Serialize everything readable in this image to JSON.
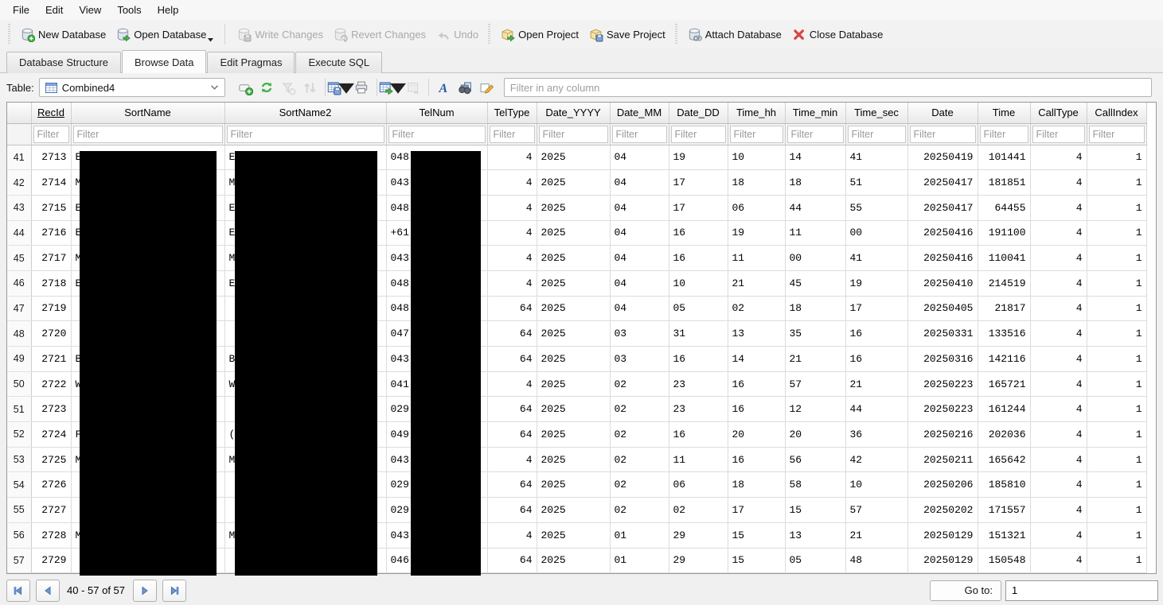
{
  "menu": {
    "items": [
      "File",
      "Edit",
      "View",
      "Tools",
      "Help"
    ]
  },
  "toolbar": {
    "buttons": [
      {
        "label": "New Database",
        "icon": "db-new",
        "enabled": true,
        "dropdown": false,
        "sep": "none"
      },
      {
        "label": "Open Database",
        "icon": "db-open",
        "enabled": true,
        "dropdown": true,
        "sep": "none"
      },
      {
        "label": "Write Changes",
        "icon": "db-write",
        "enabled": false,
        "dropdown": false,
        "sep": "line"
      },
      {
        "label": "Revert Changes",
        "icon": "db-revert",
        "enabled": false,
        "dropdown": false,
        "sep": "none"
      },
      {
        "label": "Undo",
        "icon": "undo",
        "enabled": false,
        "dropdown": false,
        "sep": "none"
      },
      {
        "label": "Open Project",
        "icon": "project-open",
        "enabled": true,
        "dropdown": false,
        "sep": "handle"
      },
      {
        "label": "Save Project",
        "icon": "project-save",
        "enabled": true,
        "dropdown": false,
        "sep": "none"
      },
      {
        "label": "Attach Database",
        "icon": "db-attach",
        "enabled": true,
        "dropdown": false,
        "sep": "handle"
      },
      {
        "label": "Close Database",
        "icon": "close-db",
        "enabled": true,
        "dropdown": false,
        "sep": "none"
      }
    ]
  },
  "tabs": [
    {
      "label": "Database Structure",
      "active": false
    },
    {
      "label": "Browse Data",
      "active": true
    },
    {
      "label": "Edit Pragmas",
      "active": false
    },
    {
      "label": "Execute SQL",
      "active": false
    }
  ],
  "browse_toolbar": {
    "table_label": "Table:",
    "table_value": "Combined4",
    "filter_placeholder": "Filter in any column",
    "icons": [
      {
        "name": "new-record",
        "enabled": true,
        "dropdown": false,
        "sep": false
      },
      {
        "name": "refresh",
        "enabled": true,
        "dropdown": false,
        "sep": false
      },
      {
        "name": "clear-filters",
        "enabled": false,
        "dropdown": false,
        "sep": false
      },
      {
        "name": "sort-records",
        "enabled": false,
        "dropdown": false,
        "sep": false
      },
      {
        "name": "save-table",
        "enabled": true,
        "dropdown": true,
        "sep": true
      },
      {
        "name": "print",
        "enabled": true,
        "dropdown": false,
        "sep": false
      },
      {
        "name": "insert-values",
        "enabled": true,
        "dropdown": true,
        "sep": true
      },
      {
        "name": "copy-table",
        "enabled": false,
        "dropdown": false,
        "sep": false
      },
      {
        "name": "font",
        "enabled": true,
        "dropdown": false,
        "sep": true
      },
      {
        "name": "find-in-cells",
        "enabled": true,
        "dropdown": false,
        "sep": false
      },
      {
        "name": "edit-cell",
        "enabled": true,
        "dropdown": false,
        "sep": false
      }
    ]
  },
  "grid": {
    "filter_placeholder": "Filter",
    "columns": [
      "RecId",
      "SortName",
      "SortName2",
      "TelNum",
      "TelType",
      "Date_YYYY",
      "Date_MM",
      "Date_DD",
      "Time_hh",
      "Time_min",
      "Time_sec",
      "Date",
      "Time",
      "CallType",
      "CallIndex"
    ],
    "rows": [
      {
        "num": "41",
        "cells": [
          "2713",
          "E",
          "E",
          "048",
          "4",
          "2025",
          "04",
          "19",
          "10",
          "14",
          "41",
          "20250419",
          "101441",
          "4",
          "1"
        ]
      },
      {
        "num": "42",
        "cells": [
          "2714",
          "M",
          "M",
          "043",
          "4",
          "2025",
          "04",
          "17",
          "18",
          "18",
          "51",
          "20250417",
          "181851",
          "4",
          "1"
        ]
      },
      {
        "num": "43",
        "cells": [
          "2715",
          "E",
          "E",
          "048",
          "4",
          "2025",
          "04",
          "17",
          "06",
          "44",
          "55",
          "20250417",
          "64455",
          "4",
          "1"
        ]
      },
      {
        "num": "44",
        "cells": [
          "2716",
          "E",
          "E",
          "+61",
          "4",
          "2025",
          "04",
          "16",
          "19",
          "11",
          "00",
          "20250416",
          "191100",
          "4",
          "1"
        ]
      },
      {
        "num": "45",
        "cells": [
          "2717",
          "M",
          "M",
          "043",
          "4",
          "2025",
          "04",
          "16",
          "11",
          "00",
          "41",
          "20250416",
          "110041",
          "4",
          "1"
        ]
      },
      {
        "num": "46",
        "cells": [
          "2718",
          "E",
          "E",
          "048",
          "4",
          "2025",
          "04",
          "10",
          "21",
          "45",
          "19",
          "20250410",
          "214519",
          "4",
          "1"
        ]
      },
      {
        "num": "47",
        "cells": [
          "2719",
          "",
          "",
          "048",
          "64",
          "2025",
          "04",
          "05",
          "02",
          "18",
          "17",
          "20250405",
          "21817",
          "4",
          "1"
        ]
      },
      {
        "num": "48",
        "cells": [
          "2720",
          "",
          "",
          "047",
          "64",
          "2025",
          "03",
          "31",
          "13",
          "35",
          "16",
          "20250331",
          "133516",
          "4",
          "1"
        ]
      },
      {
        "num": "49",
        "cells": [
          "2721",
          "B",
          "B",
          "043",
          "64",
          "2025",
          "03",
          "16",
          "14",
          "21",
          "16",
          "20250316",
          "142116",
          "4",
          "1"
        ]
      },
      {
        "num": "50",
        "cells": [
          "2722",
          "W",
          "W",
          "041",
          "4",
          "2025",
          "02",
          "23",
          "16",
          "57",
          "21",
          "20250223",
          "165721",
          "4",
          "1"
        ]
      },
      {
        "num": "51",
        "cells": [
          "2723",
          "",
          "",
          "029",
          "64",
          "2025",
          "02",
          "23",
          "16",
          "12",
          "44",
          "20250223",
          "161244",
          "4",
          "1"
        ]
      },
      {
        "num": "52",
        "cells": [
          "2724",
          "F",
          "(",
          "049",
          "64",
          "2025",
          "02",
          "16",
          "20",
          "20",
          "36",
          "20250216",
          "202036",
          "4",
          "1"
        ]
      },
      {
        "num": "53",
        "cells": [
          "2725",
          "M",
          "M",
          "043",
          "4",
          "2025",
          "02",
          "11",
          "16",
          "56",
          "42",
          "20250211",
          "165642",
          "4",
          "1"
        ]
      },
      {
        "num": "54",
        "cells": [
          "2726",
          "",
          "",
          "029",
          "64",
          "2025",
          "02",
          "06",
          "18",
          "58",
          "10",
          "20250206",
          "185810",
          "4",
          "1"
        ]
      },
      {
        "num": "55",
        "cells": [
          "2727",
          "",
          "",
          "029",
          "64",
          "2025",
          "02",
          "02",
          "17",
          "15",
          "57",
          "20250202",
          "171557",
          "4",
          "1"
        ]
      },
      {
        "num": "56",
        "cells": [
          "2728",
          "M",
          "M",
          "043",
          "4",
          "2025",
          "01",
          "29",
          "15",
          "13",
          "21",
          "20250129",
          "151321",
          "4",
          "1"
        ]
      },
      {
        "num": "57",
        "cells": [
          "2729",
          "",
          "",
          "046",
          "64",
          "2025",
          "01",
          "29",
          "15",
          "05",
          "48",
          "20250129",
          "150548",
          "4",
          "1"
        ]
      }
    ]
  },
  "pagination": {
    "range_label": "40 - 57 of 57",
    "goto_label": "Go to:",
    "goto_value": "1"
  },
  "colors": {
    "accent_green": "#3fae46",
    "accent_red": "#d64545",
    "nav_blue": "#6b96d6",
    "redaction": "#000000",
    "disabled_text": "#a9a9a9"
  }
}
